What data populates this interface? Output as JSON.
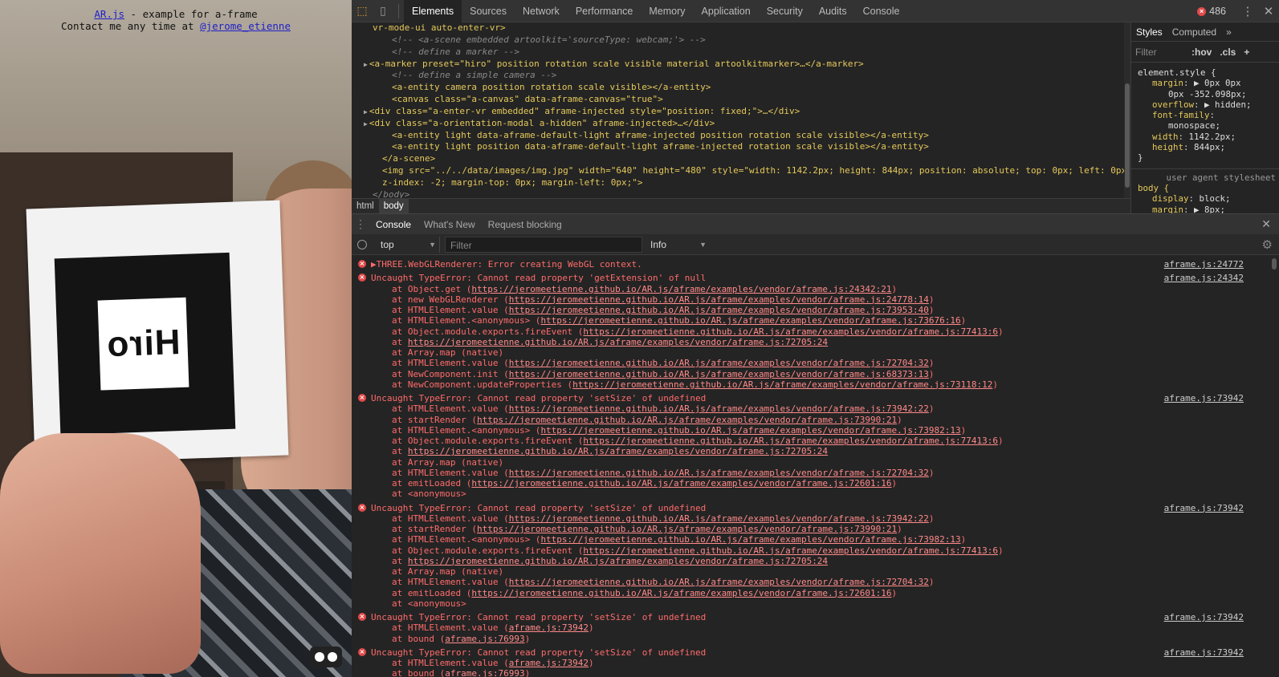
{
  "page": {
    "caption_link": "AR.js",
    "caption_rest": " - example for a-frame",
    "contact_prefix": "Contact me any time at ",
    "contact_link": "@jerome_etienne",
    "marker_text": "Hiro",
    "vr_button": "vr-goggles-icon"
  },
  "devtools": {
    "tabs": [
      "Elements",
      "Sources",
      "Network",
      "Performance",
      "Memory",
      "Application",
      "Security",
      "Audits",
      "Console"
    ],
    "active_tab": "Elements",
    "error_count": "486",
    "elements_lines": [
      {
        "indent": 0,
        "html": "vr-mode-ui auto-enter-vr&gt;"
      },
      {
        "indent": 1,
        "cmt": "<!-- <a-scene embedded artoolkit='sourceType: webcam;'> -->"
      },
      {
        "indent": 1,
        "cmt": "<!-- define a marker -->"
      },
      {
        "indent": 0,
        "tri": true,
        "tagline": "<a-marker preset=\"hiro\" position rotation scale visible material artoolkitmarker>…</a-marker>"
      },
      {
        "indent": 1,
        "cmt": "<!-- define a simple camera -->"
      },
      {
        "indent": 1,
        "tagline": "<a-entity camera position rotation scale visible></a-entity>"
      },
      {
        "indent": 1,
        "tagline": "<canvas class=\"a-canvas\" data-aframe-canvas=\"true\">"
      },
      {
        "indent": 0,
        "tri": true,
        "tagline": "<div class=\"a-enter-vr embedded\" aframe-injected style=\"position: fixed;\">…</div>"
      },
      {
        "indent": 0,
        "tri": true,
        "tagline": "<div class=\"a-orientation-modal a-hidden\" aframe-injected>…</div>"
      },
      {
        "indent": 1,
        "tagline": "<a-entity light data-aframe-default-light aframe-injected position rotation scale visible></a-entity>"
      },
      {
        "indent": 1,
        "tagline": "<a-entity light position data-aframe-default-light aframe-injected rotation scale visible></a-entity>"
      },
      {
        "indent": -1,
        "tagline": "</a-scene>"
      },
      {
        "indent": -1,
        "tagline": "<img src=\"../../data/images/img.jpg\" width=\"640\" height=\"480\" style=\"width: 1142.2px; height: 844px; position: absolute; top: 0px; left: 0px;"
      },
      {
        "indent": -1,
        "tagline": "z-index: -2; margin-top: 0px; margin-left: 0px;\">"
      },
      {
        "indent": -2,
        "cmt": "</body>"
      }
    ],
    "breadcrumbs": [
      "html",
      "body"
    ],
    "active_crumb": "body",
    "styles": {
      "tabs": [
        "Styles",
        "Computed"
      ],
      "filter_placeholder": "Filter",
      "hov": ":hov",
      "cls": ".cls",
      "element_style": "element.style {",
      "props": [
        {
          "name": "margin",
          "value": "▶ 0px 0px"
        },
        {
          "name": "",
          "value": "0px -352.098px;"
        },
        {
          "name": "overflow",
          "value": "▶ hidden;"
        },
        {
          "name": "font-family",
          "value": ""
        },
        {
          "name": "",
          "value": "monospace;"
        },
        {
          "name": "width",
          "value": "1142.2px;"
        },
        {
          "name": "height",
          "value": "844px;"
        }
      ],
      "close_brace": "}",
      "ua_label": "user agent stylesheet",
      "body_sel": "body {",
      "ua_props": [
        {
          "name": "display",
          "value": "block;"
        },
        {
          "name": "margin",
          "value": "▶ 8px;"
        }
      ]
    },
    "drawer": {
      "tabs": [
        "Console",
        "What's New",
        "Request blocking"
      ],
      "context": "top",
      "filter_placeholder": "Filter",
      "level": "Info"
    },
    "console": [
      {
        "head": "▶THREE.WebGLRenderer: Error creating WebGL context.",
        "src": "aframe.js:24772",
        "frames": []
      },
      {
        "head": "Uncaught TypeError: Cannot read property 'getExtension' of null",
        "src": "aframe.js:24342",
        "frames": [
          [
            "at Object.get (",
            "https://jeromeetienne.github.io/AR.js/aframe/examples/vendor/aframe.js:24342:21",
            ")"
          ],
          [
            "at new WebGLRenderer (",
            "https://jeromeetienne.github.io/AR.js/aframe/examples/vendor/aframe.js:24778:14",
            ")"
          ],
          [
            "at HTMLElement.value (",
            "https://jeromeetienne.github.io/AR.js/aframe/examples/vendor/aframe.js:73953:40",
            ")"
          ],
          [
            "at HTMLElement.<anonymous> (",
            "https://jeromeetienne.github.io/AR.js/aframe/examples/vendor/aframe.js:73676:16",
            ")"
          ],
          [
            "at Object.module.exports.fireEvent (",
            "https://jeromeetienne.github.io/AR.js/aframe/examples/vendor/aframe.js:77413:6",
            ")"
          ],
          [
            "at ",
            "https://jeromeetienne.github.io/AR.js/aframe/examples/vendor/aframe.js:72705:24",
            ""
          ],
          [
            "at Array.map (native)",
            "",
            ""
          ],
          [
            "at HTMLElement.value (",
            "https://jeromeetienne.github.io/AR.js/aframe/examples/vendor/aframe.js:72704:32",
            ")"
          ],
          [
            "at NewComponent.init (",
            "https://jeromeetienne.github.io/AR.js/aframe/examples/vendor/aframe.js:68373:13",
            ")"
          ],
          [
            "at NewComponent.updateProperties (",
            "https://jeromeetienne.github.io/AR.js/aframe/examples/vendor/aframe.js:73118:12",
            ")"
          ]
        ]
      },
      {
        "head": "Uncaught TypeError: Cannot read property 'setSize' of undefined",
        "src": "aframe.js:73942",
        "frames": [
          [
            "at HTMLElement.value (",
            "https://jeromeetienne.github.io/AR.js/aframe/examples/vendor/aframe.js:73942:22",
            ")"
          ],
          [
            "at startRender (",
            "https://jeromeetienne.github.io/AR.js/aframe/examples/vendor/aframe.js:73990:21",
            ")"
          ],
          [
            "at HTMLElement.<anonymous> (",
            "https://jeromeetienne.github.io/AR.js/aframe/examples/vendor/aframe.js:73982:13",
            ")"
          ],
          [
            "at Object.module.exports.fireEvent (",
            "https://jeromeetienne.github.io/AR.js/aframe/examples/vendor/aframe.js:77413:6",
            ")"
          ],
          [
            "at ",
            "https://jeromeetienne.github.io/AR.js/aframe/examples/vendor/aframe.js:72705:24",
            ""
          ],
          [
            "at Array.map (native)",
            "",
            ""
          ],
          [
            "at HTMLElement.value (",
            "https://jeromeetienne.github.io/AR.js/aframe/examples/vendor/aframe.js:72704:32",
            ")"
          ],
          [
            "at emitLoaded (",
            "https://jeromeetienne.github.io/AR.js/aframe/examples/vendor/aframe.js:72601:16",
            ")"
          ],
          [
            "at <anonymous>",
            "",
            ""
          ]
        ]
      },
      {
        "head": "Uncaught TypeError: Cannot read property 'setSize' of undefined",
        "src": "aframe.js:73942",
        "frames": [
          [
            "at HTMLElement.value (",
            "https://jeromeetienne.github.io/AR.js/aframe/examples/vendor/aframe.js:73942:22",
            ")"
          ],
          [
            "at startRender (",
            "https://jeromeetienne.github.io/AR.js/aframe/examples/vendor/aframe.js:73990:21",
            ")"
          ],
          [
            "at HTMLElement.<anonymous> (",
            "https://jeromeetienne.github.io/AR.js/aframe/examples/vendor/aframe.js:73982:13",
            ")"
          ],
          [
            "at Object.module.exports.fireEvent (",
            "https://jeromeetienne.github.io/AR.js/aframe/examples/vendor/aframe.js:77413:6",
            ")"
          ],
          [
            "at ",
            "https://jeromeetienne.github.io/AR.js/aframe/examples/vendor/aframe.js:72705:24",
            ""
          ],
          [
            "at Array.map (native)",
            "",
            ""
          ],
          [
            "at HTMLElement.value (",
            "https://jeromeetienne.github.io/AR.js/aframe/examples/vendor/aframe.js:72704:32",
            ")"
          ],
          [
            "at emitLoaded (",
            "https://jeromeetienne.github.io/AR.js/aframe/examples/vendor/aframe.js:72601:16",
            ")"
          ],
          [
            "at <anonymous>",
            "",
            ""
          ]
        ]
      },
      {
        "head": "Uncaught TypeError: Cannot read property 'setSize' of undefined",
        "src": "aframe.js:73942",
        "frames": [
          [
            "at HTMLElement.value (",
            "aframe.js:73942",
            ")"
          ],
          [
            "at bound (",
            "aframe.js:76993",
            ")"
          ]
        ]
      },
      {
        "head": "Uncaught TypeError: Cannot read property 'setSize' of undefined",
        "src": "aframe.js:73942",
        "frames": [
          [
            "at HTMLElement.value (",
            "aframe.js:73942",
            ")"
          ],
          [
            "at bound (",
            "aframe.js:76993",
            ")"
          ]
        ]
      }
    ]
  },
  "colors": {
    "error_red": "#ff6b6b",
    "tag_yellow": "#e5c95b",
    "devtools_bg": "#242424",
    "link_blue": "#2020c8"
  }
}
